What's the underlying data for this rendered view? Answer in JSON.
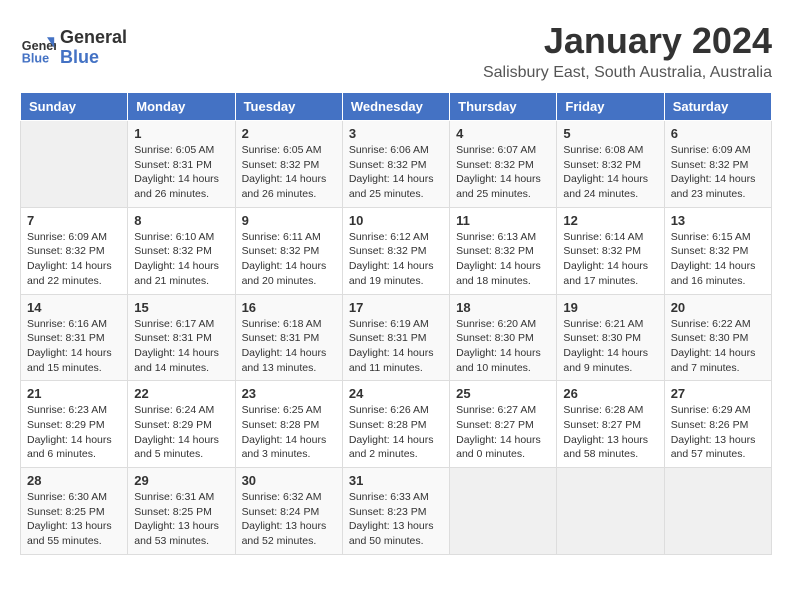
{
  "header": {
    "logo_line1": "General",
    "logo_line2": "Blue",
    "month": "January 2024",
    "location": "Salisbury East, South Australia, Australia"
  },
  "weekdays": [
    "Sunday",
    "Monday",
    "Tuesday",
    "Wednesday",
    "Thursday",
    "Friday",
    "Saturday"
  ],
  "weeks": [
    [
      {
        "day": "",
        "content": ""
      },
      {
        "day": "1",
        "content": "Sunrise: 6:05 AM\nSunset: 8:31 PM\nDaylight: 14 hours\nand 26 minutes."
      },
      {
        "day": "2",
        "content": "Sunrise: 6:05 AM\nSunset: 8:32 PM\nDaylight: 14 hours\nand 26 minutes."
      },
      {
        "day": "3",
        "content": "Sunrise: 6:06 AM\nSunset: 8:32 PM\nDaylight: 14 hours\nand 25 minutes."
      },
      {
        "day": "4",
        "content": "Sunrise: 6:07 AM\nSunset: 8:32 PM\nDaylight: 14 hours\nand 25 minutes."
      },
      {
        "day": "5",
        "content": "Sunrise: 6:08 AM\nSunset: 8:32 PM\nDaylight: 14 hours\nand 24 minutes."
      },
      {
        "day": "6",
        "content": "Sunrise: 6:09 AM\nSunset: 8:32 PM\nDaylight: 14 hours\nand 23 minutes."
      }
    ],
    [
      {
        "day": "7",
        "content": "Sunrise: 6:09 AM\nSunset: 8:32 PM\nDaylight: 14 hours\nand 22 minutes."
      },
      {
        "day": "8",
        "content": "Sunrise: 6:10 AM\nSunset: 8:32 PM\nDaylight: 14 hours\nand 21 minutes."
      },
      {
        "day": "9",
        "content": "Sunrise: 6:11 AM\nSunset: 8:32 PM\nDaylight: 14 hours\nand 20 minutes."
      },
      {
        "day": "10",
        "content": "Sunrise: 6:12 AM\nSunset: 8:32 PM\nDaylight: 14 hours\nand 19 minutes."
      },
      {
        "day": "11",
        "content": "Sunrise: 6:13 AM\nSunset: 8:32 PM\nDaylight: 14 hours\nand 18 minutes."
      },
      {
        "day": "12",
        "content": "Sunrise: 6:14 AM\nSunset: 8:32 PM\nDaylight: 14 hours\nand 17 minutes."
      },
      {
        "day": "13",
        "content": "Sunrise: 6:15 AM\nSunset: 8:32 PM\nDaylight: 14 hours\nand 16 minutes."
      }
    ],
    [
      {
        "day": "14",
        "content": "Sunrise: 6:16 AM\nSunset: 8:31 PM\nDaylight: 14 hours\nand 15 minutes."
      },
      {
        "day": "15",
        "content": "Sunrise: 6:17 AM\nSunset: 8:31 PM\nDaylight: 14 hours\nand 14 minutes."
      },
      {
        "day": "16",
        "content": "Sunrise: 6:18 AM\nSunset: 8:31 PM\nDaylight: 14 hours\nand 13 minutes."
      },
      {
        "day": "17",
        "content": "Sunrise: 6:19 AM\nSunset: 8:31 PM\nDaylight: 14 hours\nand 11 minutes."
      },
      {
        "day": "18",
        "content": "Sunrise: 6:20 AM\nSunset: 8:30 PM\nDaylight: 14 hours\nand 10 minutes."
      },
      {
        "day": "19",
        "content": "Sunrise: 6:21 AM\nSunset: 8:30 PM\nDaylight: 14 hours\nand 9 minutes."
      },
      {
        "day": "20",
        "content": "Sunrise: 6:22 AM\nSunset: 8:30 PM\nDaylight: 14 hours\nand 7 minutes."
      }
    ],
    [
      {
        "day": "21",
        "content": "Sunrise: 6:23 AM\nSunset: 8:29 PM\nDaylight: 14 hours\nand 6 minutes."
      },
      {
        "day": "22",
        "content": "Sunrise: 6:24 AM\nSunset: 8:29 PM\nDaylight: 14 hours\nand 5 minutes."
      },
      {
        "day": "23",
        "content": "Sunrise: 6:25 AM\nSunset: 8:28 PM\nDaylight: 14 hours\nand 3 minutes."
      },
      {
        "day": "24",
        "content": "Sunrise: 6:26 AM\nSunset: 8:28 PM\nDaylight: 14 hours\nand 2 minutes."
      },
      {
        "day": "25",
        "content": "Sunrise: 6:27 AM\nSunset: 8:27 PM\nDaylight: 14 hours\nand 0 minutes."
      },
      {
        "day": "26",
        "content": "Sunrise: 6:28 AM\nSunset: 8:27 PM\nDaylight: 13 hours\nand 58 minutes."
      },
      {
        "day": "27",
        "content": "Sunrise: 6:29 AM\nSunset: 8:26 PM\nDaylight: 13 hours\nand 57 minutes."
      }
    ],
    [
      {
        "day": "28",
        "content": "Sunrise: 6:30 AM\nSunset: 8:25 PM\nDaylight: 13 hours\nand 55 minutes."
      },
      {
        "day": "29",
        "content": "Sunrise: 6:31 AM\nSunset: 8:25 PM\nDaylight: 13 hours\nand 53 minutes."
      },
      {
        "day": "30",
        "content": "Sunrise: 6:32 AM\nSunset: 8:24 PM\nDaylight: 13 hours\nand 52 minutes."
      },
      {
        "day": "31",
        "content": "Sunrise: 6:33 AM\nSunset: 8:23 PM\nDaylight: 13 hours\nand 50 minutes."
      },
      {
        "day": "",
        "content": ""
      },
      {
        "day": "",
        "content": ""
      },
      {
        "day": "",
        "content": ""
      }
    ]
  ]
}
